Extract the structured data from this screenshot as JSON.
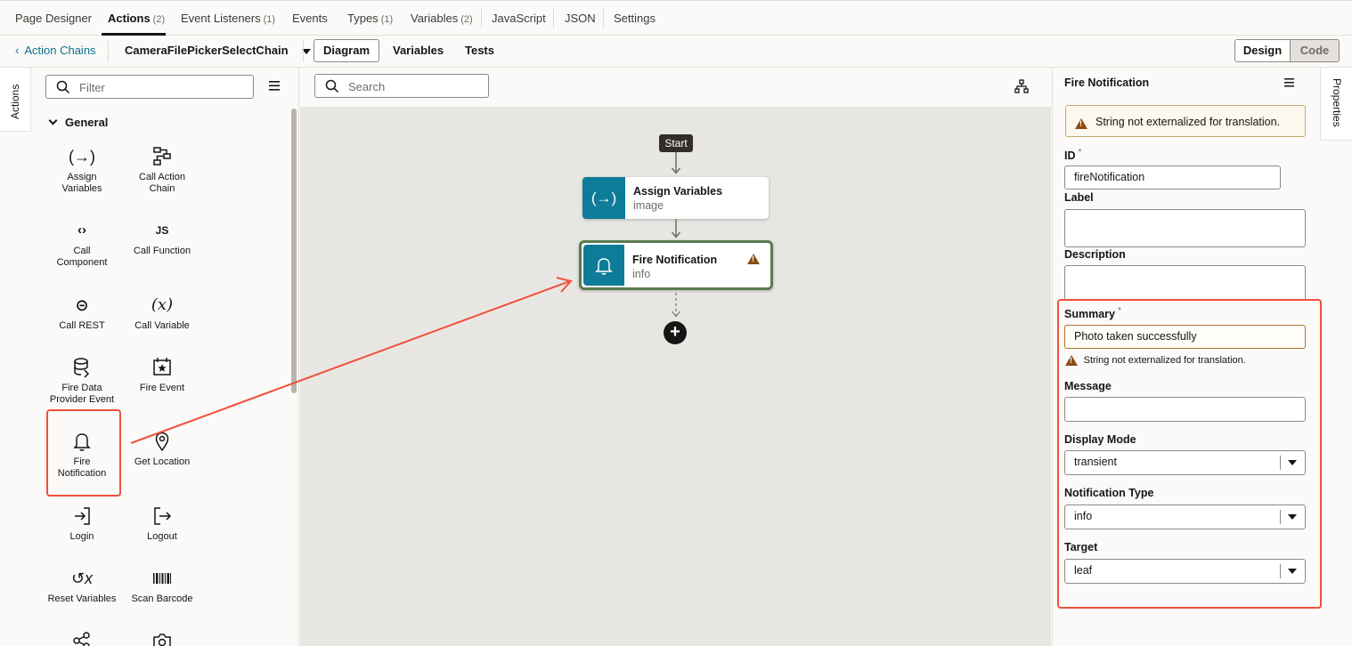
{
  "top_tabs": [
    {
      "label": "Page Designer",
      "count": ""
    },
    {
      "label": "Actions",
      "count": "(2)"
    },
    {
      "label": "Event Listeners",
      "count": "(1)"
    },
    {
      "label": "Events",
      "count": ""
    },
    {
      "label": "Types",
      "count": "(1)"
    },
    {
      "label": "Variables",
      "count": "(2)"
    },
    {
      "label": "JavaScript",
      "count": ""
    },
    {
      "label": "JSON",
      "count": ""
    },
    {
      "label": "Settings",
      "count": ""
    }
  ],
  "toolbar": {
    "back_label": "Action Chains",
    "chain_name": "CameraFilePickerSelectChain",
    "view_tabs": [
      "Diagram",
      "Variables",
      "Tests"
    ],
    "design_label": "Design",
    "code_label": "Code"
  },
  "left_vtab_label": "Actions",
  "palette": {
    "filter_placeholder": "Filter",
    "section_title": "General",
    "items": [
      {
        "label": "Assign Variables",
        "icon": "assign-variables-icon"
      },
      {
        "label": "Call Action Chain",
        "icon": "call-action-chain-icon"
      },
      {
        "label": "Call Component",
        "icon": "call-component-icon"
      },
      {
        "label": "Call Function",
        "icon": "call-function-icon"
      },
      {
        "label": "Call REST",
        "icon": "call-rest-icon"
      },
      {
        "label": "Call Variable",
        "icon": "call-variable-icon"
      },
      {
        "label": "Fire Data Provider Event",
        "icon": "fire-data-provider-event-icon"
      },
      {
        "label": "Fire Event",
        "icon": "fire-event-icon"
      },
      {
        "label": "Fire Notification",
        "icon": "bell-icon"
      },
      {
        "label": "Get Location",
        "icon": "location-pin-icon"
      },
      {
        "label": "Login",
        "icon": "login-icon"
      },
      {
        "label": "Logout",
        "icon": "logout-icon"
      },
      {
        "label": "Reset Variables",
        "icon": "reset-variables-icon"
      },
      {
        "label": "Scan Barcode",
        "icon": "barcode-icon"
      },
      {
        "label": "",
        "icon": "share-icon"
      },
      {
        "label": "",
        "icon": "camera-icon"
      }
    ]
  },
  "canvas": {
    "search_placeholder": "Search",
    "start_label": "Start",
    "nodes": [
      {
        "title": "Assign Variables",
        "subtitle": "image"
      },
      {
        "title": "Fire Notification",
        "subtitle": "info"
      }
    ]
  },
  "properties": {
    "vtab_label": "Properties",
    "title": "Fire Notification",
    "banner_warning": "String not externalized for translation.",
    "id_label": "ID",
    "required_mark": "*",
    "id_value": "fireNotification",
    "label_label": "Label",
    "label_value": "",
    "description_label": "Description",
    "description_value": "",
    "summary_label": "Summary",
    "summary_value": "Photo taken successfully",
    "summary_warning": "String not externalized for translation.",
    "message_label": "Message",
    "message_value": "",
    "display_mode_label": "Display Mode",
    "display_mode_value": "transient",
    "notification_type_label": "Notification Type",
    "notification_type_value": "info",
    "target_label": "Target",
    "target_value": "leaf"
  },
  "colors": {
    "accent_teal": "#0e7c99",
    "selected_node_border": "#5a7a4f",
    "warning": "#8a4b12",
    "annotation": "#f0503c"
  }
}
